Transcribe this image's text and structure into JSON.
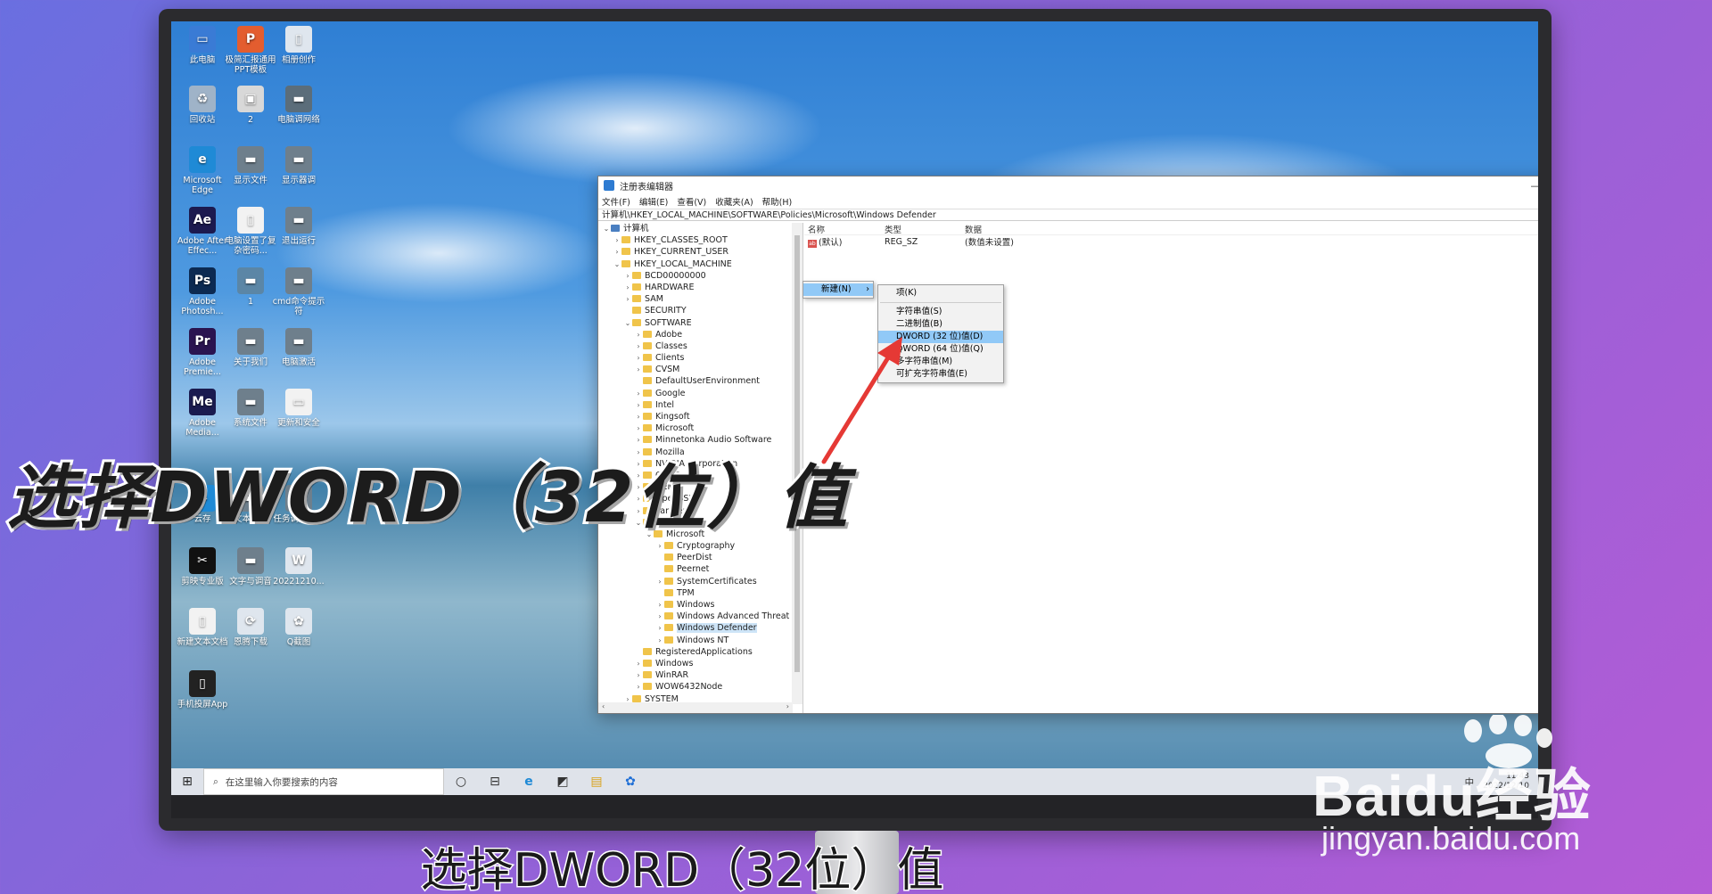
{
  "desktop_icons": [
    {
      "label": "此电脑",
      "color": "#3a7bd5",
      "glyph": "▭"
    },
    {
      "label": "极简汇报通用PPT模板",
      "color": "#e35d2f",
      "glyph": "P"
    },
    {
      "label": "相册创作",
      "color": "#dfe6ee",
      "glyph": "▯"
    },
    {
      "label": "回收站",
      "color": "#9fb3c8",
      "glyph": "♻"
    },
    {
      "label": "2",
      "color": "#d8d8d8",
      "glyph": "▣"
    },
    {
      "label": "电脑调网络",
      "color": "#5b6d7a",
      "glyph": "▬"
    },
    {
      "label": "Microsoft Edge",
      "color": "#1f8ad6",
      "glyph": "e"
    },
    {
      "label": "显示文件",
      "color": "#6e7f8c",
      "glyph": "▬"
    },
    {
      "label": "显示器调",
      "color": "#6e7f8c",
      "glyph": "▬"
    },
    {
      "label": "Adobe After Effec...",
      "color": "#1c1a4f",
      "glyph": "Ae"
    },
    {
      "label": "电脑设置了复杂密码...",
      "color": "#f2f2f2",
      "glyph": "▯"
    },
    {
      "label": "退出运行",
      "color": "#6e7f8c",
      "glyph": "▬"
    },
    {
      "label": "Adobe Photosh...",
      "color": "#0c2a52",
      "glyph": "Ps"
    },
    {
      "label": "1",
      "color": "#5b86a6",
      "glyph": "▬"
    },
    {
      "label": "cmd命令提示符",
      "color": "#6e7f8c",
      "glyph": "▬"
    },
    {
      "label": "Adobe Premie...",
      "color": "#2a1450",
      "glyph": "Pr"
    },
    {
      "label": "关于我们",
      "color": "#6e7f8c",
      "glyph": "▬"
    },
    {
      "label": "电脑激活",
      "color": "#6e7f8c",
      "glyph": "▬"
    },
    {
      "label": "Adobe Media...",
      "color": "#1a1b4f",
      "glyph": "Me"
    },
    {
      "label": "系统文件",
      "color": "#6e7f8c",
      "glyph": "▬"
    },
    {
      "label": "更新和安全",
      "color": "#f2f2f2",
      "glyph": "▭"
    },
    {
      "label": "云存",
      "color": "#1f8ad6",
      "glyph": "◆"
    },
    {
      "label": "文本分析",
      "color": "#6e7f8c",
      "glyph": "▬"
    },
    {
      "label": "任务调度编辑",
      "color": "#6e7f8c",
      "glyph": "▬"
    },
    {
      "label": "剪映专业版",
      "color": "#111111",
      "glyph": "✂"
    },
    {
      "label": "文字与调音",
      "color": "#6e7f8c",
      "glyph": "▬"
    },
    {
      "label": "20221210...",
      "color": "#dfe6ee",
      "glyph": "W"
    },
    {
      "label": "新建文本文档",
      "color": "#f2f2f2",
      "glyph": "▯"
    },
    {
      "label": "恩腾下载",
      "color": "#dfe6ee",
      "glyph": "⟳"
    },
    {
      "label": "Q截图",
      "color": "#dfe6ee",
      "glyph": "✿"
    },
    {
      "label": "手机投屏App",
      "color": "#222222",
      "glyph": "▯"
    }
  ],
  "regedit": {
    "title": "注册表编辑器",
    "controls": [
      "—",
      "☐",
      "✕"
    ],
    "menu": [
      "文件(F)",
      "编辑(E)",
      "查看(V)",
      "收藏夹(A)",
      "帮助(H)"
    ],
    "address": "计算机\\HKEY_LOCAL_MACHINE\\SOFTWARE\\Policies\\Microsoft\\Windows Defender",
    "tree": [
      {
        "label": "计算机",
        "indent": 0,
        "chev": "⌄",
        "folder": false
      },
      {
        "label": "HKEY_CLASSES_ROOT",
        "indent": 1,
        "chev": "›",
        "folder": true
      },
      {
        "label": "HKEY_CURRENT_USER",
        "indent": 1,
        "chev": "›",
        "folder": true
      },
      {
        "label": "HKEY_LOCAL_MACHINE",
        "indent": 1,
        "chev": "⌄",
        "folder": true
      },
      {
        "label": "BCD00000000",
        "indent": 2,
        "chev": "›",
        "folder": true
      },
      {
        "label": "HARDWARE",
        "indent": 2,
        "chev": "›",
        "folder": true
      },
      {
        "label": "SAM",
        "indent": 2,
        "chev": "›",
        "folder": true
      },
      {
        "label": "SECURITY",
        "indent": 2,
        "chev": "",
        "folder": true
      },
      {
        "label": "SOFTWARE",
        "indent": 2,
        "chev": "⌄",
        "folder": true
      },
      {
        "label": "Adobe",
        "indent": 3,
        "chev": "›",
        "folder": true
      },
      {
        "label": "Classes",
        "indent": 3,
        "chev": "›",
        "folder": true
      },
      {
        "label": "Clients",
        "indent": 3,
        "chev": "›",
        "folder": true
      },
      {
        "label": "CVSM",
        "indent": 3,
        "chev": "›",
        "folder": true
      },
      {
        "label": "DefaultUserEnvironment",
        "indent": 3,
        "chev": "",
        "folder": true
      },
      {
        "label": "Google",
        "indent": 3,
        "chev": "›",
        "folder": true
      },
      {
        "label": "Intel",
        "indent": 3,
        "chev": "›",
        "folder": true
      },
      {
        "label": "Kingsoft",
        "indent": 3,
        "chev": "›",
        "folder": true
      },
      {
        "label": "Microsoft",
        "indent": 3,
        "chev": "›",
        "folder": true
      },
      {
        "label": "Minnetonka Audio Software",
        "indent": 3,
        "chev": "›",
        "folder": true
      },
      {
        "label": "Mozilla",
        "indent": 3,
        "chev": "›",
        "folder": true
      },
      {
        "label": "NVIDIA Corporation",
        "indent": 3,
        "chev": "›",
        "folder": true
      },
      {
        "label": "ODBC",
        "indent": 3,
        "chev": "›",
        "folder": true
      },
      {
        "label": "OEM",
        "indent": 3,
        "chev": "›",
        "folder": true
      },
      {
        "label": "OpenSSH",
        "indent": 3,
        "chev": "›",
        "folder": true
      },
      {
        "label": "Partner",
        "indent": 3,
        "chev": "›",
        "folder": true
      },
      {
        "label": "Policies",
        "indent": 3,
        "chev": "⌄",
        "folder": true
      },
      {
        "label": "Microsoft",
        "indent": 4,
        "chev": "⌄",
        "folder": true
      },
      {
        "label": "Cryptography",
        "indent": 5,
        "chev": "›",
        "folder": true
      },
      {
        "label": "PeerDist",
        "indent": 5,
        "chev": "",
        "folder": true
      },
      {
        "label": "Peernet",
        "indent": 5,
        "chev": "",
        "folder": true
      },
      {
        "label": "SystemCertificates",
        "indent": 5,
        "chev": "›",
        "folder": true
      },
      {
        "label": "TPM",
        "indent": 5,
        "chev": "",
        "folder": true
      },
      {
        "label": "Windows",
        "indent": 5,
        "chev": "›",
        "folder": true
      },
      {
        "label": "Windows Advanced Threat P",
        "indent": 5,
        "chev": "›",
        "folder": true
      },
      {
        "label": "Windows Defender",
        "indent": 5,
        "chev": "›",
        "folder": true,
        "selected": true
      },
      {
        "label": "Windows NT",
        "indent": 5,
        "chev": "›",
        "folder": true
      },
      {
        "label": "RegisteredApplications",
        "indent": 3,
        "chev": "",
        "folder": true
      },
      {
        "label": "Windows",
        "indent": 3,
        "chev": "›",
        "folder": true
      },
      {
        "label": "WinRAR",
        "indent": 3,
        "chev": "›",
        "folder": true
      },
      {
        "label": "WOW6432Node",
        "indent": 3,
        "chev": "›",
        "folder": true
      },
      {
        "label": "SYSTEM",
        "indent": 2,
        "chev": "›",
        "folder": true
      }
    ],
    "value_headers": [
      "名称",
      "类型",
      "数据"
    ],
    "values": [
      {
        "name": "(默认)",
        "type": "REG_SZ",
        "data": "(数值未设置)"
      }
    ]
  },
  "context_menu": {
    "new_label": "新建(N)",
    "arrow": "›"
  },
  "submenu": {
    "items": [
      "项(K)",
      "字符串值(S)",
      "二进制值(B)",
      "DWORD (32 位)值(D)",
      "QWORD (64 位)值(Q)",
      "多字符串值(M)",
      "可扩充字符串值(E)"
    ],
    "highlighted_index": 3
  },
  "taskbar": {
    "start_glyph": "⊞",
    "search_placeholder": "在这里输入你要搜索的内容",
    "icons": [
      "○",
      "⊟",
      "e",
      "◩",
      "▤",
      "✿"
    ],
    "tray_lang": "中",
    "time": "11:43",
    "date": "2022/12/10"
  },
  "captions": {
    "overlay": "选择DWORD（32位）值",
    "subtitle": "选择DWORD（32位）值"
  },
  "watermark": {
    "brand": "Baidu经验",
    "url": "jingyan.baidu.com"
  },
  "colors": {
    "arrow": "#e53935",
    "highlight": "#91c9f7",
    "selected_tree": "#cde4f7",
    "folder": "#f0c44a"
  }
}
